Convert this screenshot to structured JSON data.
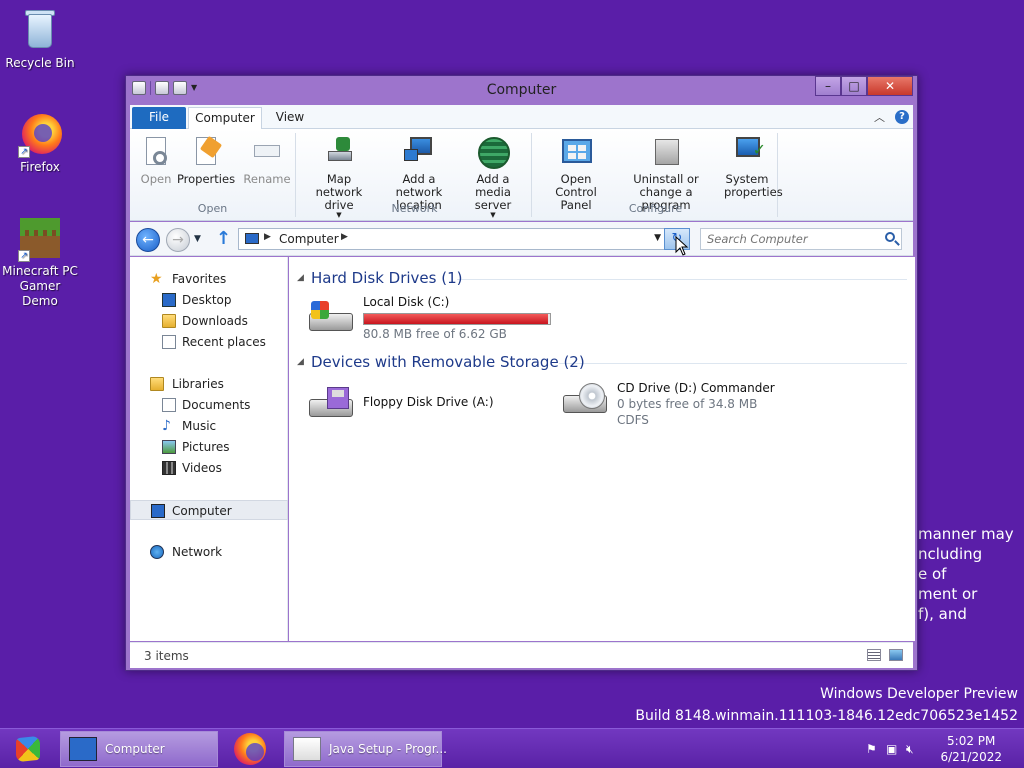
{
  "desktop": {
    "icons": [
      {
        "label": "Recycle Bin"
      },
      {
        "label": "Firefox"
      },
      {
        "label": "Minecraft PC Gamer Demo"
      }
    ],
    "watermark_lines": [
      "manner may",
      "ncluding",
      "e of",
      "ment or",
      "f), and"
    ],
    "build_line1": "Windows Developer Preview",
    "build_line2": "Build 8148.winmain.111103-1846.12edc706523e1452"
  },
  "window": {
    "title": "Computer",
    "tabs": {
      "file": "File",
      "computer": "Computer",
      "view": "View"
    },
    "ribbon": {
      "open_group": {
        "label": "Open",
        "open": "Open",
        "properties": "Properties",
        "rename": "Rename"
      },
      "network_group": {
        "label": "Network",
        "map_drive": "Map network drive",
        "add_location": "Add a network location",
        "add_media": "Add a media server"
      },
      "configure_group": {
        "label": "Configure",
        "control_panel": "Open Control Panel",
        "uninstall": "Uninstall or change a program",
        "system": "System properties"
      }
    },
    "address": {
      "crumb": "Computer"
    },
    "search": {
      "placeholder": "Search Computer"
    },
    "nav": {
      "favorites": "Favorites",
      "desktop": "Desktop",
      "downloads": "Downloads",
      "recent": "Recent places",
      "libraries": "Libraries",
      "documents": "Documents",
      "music": "Music",
      "pictures": "Pictures",
      "videos": "Videos",
      "computer": "Computer",
      "network": "Network"
    },
    "content": {
      "hdd_header": "Hard Disk Drives (1)",
      "removable_header": "Devices with Removable Storage (2)",
      "drives": {
        "c": {
          "name": "Local Disk (C:)",
          "free": "80.8 MB free of 6.62 GB",
          "used_fraction": 0.988
        },
        "a": {
          "name": "Floppy Disk Drive (A:)"
        },
        "d": {
          "name": "CD Drive (D:) Commander",
          "free": "0 bytes free of 34.8 MB",
          "fs": "CDFS"
        }
      }
    },
    "status": {
      "items": "3 items"
    }
  },
  "taskbar": {
    "buttons": {
      "computer": "Computer",
      "java": "Java Setup - Progr..."
    },
    "clock": {
      "time": "5:02 PM",
      "date": "6/21/2022"
    }
  },
  "colors": {
    "desktop": "#5a1ea8",
    "window_frame": "#9d74cc",
    "accent": "#1e6bc0",
    "disk_bar": "#d01c24"
  }
}
